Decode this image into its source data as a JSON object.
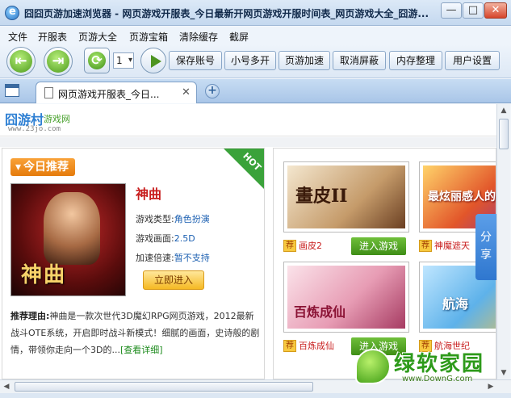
{
  "window": {
    "title": "囧囧页游加速浏览器 - 网页游戏开服表_今日最新开网页游戏开服时间表_网页游戏大全_囧游...",
    "min": "—",
    "max": "□",
    "close": "✕"
  },
  "menu": [
    "文件",
    "开服表",
    "页游大全",
    "页游宝箱",
    "清除缓存",
    "截屏"
  ],
  "toolbar": {
    "back_icon": "back-arrow-icon",
    "forward_icon": "forward-arrow-icon",
    "count_value": "1",
    "buttons": [
      "保存账号",
      "小号多开",
      "页游加速",
      "取消屏蔽",
      "内存整理",
      "用户设置"
    ]
  },
  "tab": {
    "label": "网页游戏开服表_今日...",
    "close": "✕",
    "new_tab": "+"
  },
  "site": {
    "logo": "囧游村",
    "logo_sub": "游戏网",
    "url": "www.23jo.com"
  },
  "featured": {
    "badge": "今日推荐",
    "hot": "HOT",
    "cover_text": "神曲",
    "name": "神曲",
    "type_label": "游戏类型:",
    "type_value": "角色扮演",
    "screen_label": "游戏画面:",
    "screen_value": "2.5D",
    "speed_label": "加速倍速:",
    "speed_value": "暂不支持",
    "enter": "立即进入",
    "reason_label": "推荐理由:",
    "reason_text": "神曲是一款次世代3D魔幻RPG网页游戏，2012最新战斗OTE系统，开启即时战斗新模式！细腻的画面，史诗般的剧情，带领你走向一个3D的...",
    "more": "[查看详细]"
  },
  "games": [
    {
      "tag": "荐",
      "name": "画皮2",
      "thumb_text": "畫皮II",
      "button": "进入游戏"
    },
    {
      "tag": "荐",
      "name": "神魔遮天",
      "thumb_text": "最炫丽感人的",
      "button": ""
    },
    {
      "tag": "荐",
      "name": "百炼成仙",
      "thumb_text": "百炼成仙",
      "button": "进入游戏"
    },
    {
      "tag": "荐",
      "name": "航海世纪",
      "thumb_text": "航海",
      "button": ""
    }
  ],
  "share": "分享",
  "watermark": {
    "name": "绿软家园",
    "url": "www.DownG.com"
  },
  "colors": {
    "accent": "#2f77cf",
    "brand_green": "#3f8e17",
    "highlight_red": "#c81d1d",
    "badge_orange": "#e57b0c"
  }
}
